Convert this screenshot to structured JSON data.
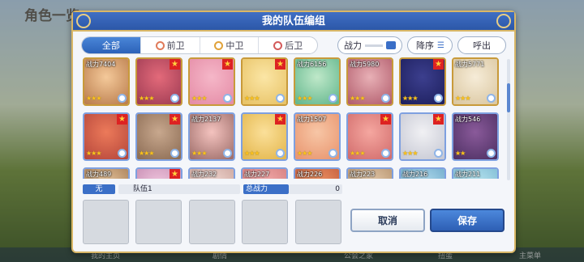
{
  "background": {
    "title": "角色一览",
    "nav": [
      "我的主页",
      "剧情",
      "公会之家",
      "扭蛋",
      "主菜单"
    ]
  },
  "modal": {
    "title": "我的队伍编组"
  },
  "filters": [
    {
      "label": "全部",
      "active": true
    },
    {
      "label": "前卫",
      "active": false
    },
    {
      "label": "中卫",
      "active": false
    },
    {
      "label": "后卫",
      "active": false
    }
  ],
  "controls": {
    "sort_field": "战力",
    "sort_order": "降序",
    "call_out": "呼出"
  },
  "colors": {
    "header": "#2c57a8",
    "gold_border": "#d9b767",
    "accent": "#3b6fc7"
  },
  "roster": [
    {
      "power": "战力7404",
      "stars": "★★★",
      "rare_mark": false,
      "frame": "gold",
      "art": [
        "#f4c99a",
        "#b87a4a"
      ]
    },
    {
      "power": "",
      "stars": "★★★",
      "rare_mark": true,
      "frame": "gold",
      "art": [
        "#e36a7a",
        "#9c3a52"
      ]
    },
    {
      "power": "",
      "stars": "★★★",
      "rare_mark": true,
      "frame": "gold",
      "art": [
        "#f5b7c8",
        "#e48aa5"
      ]
    },
    {
      "power": "",
      "stars": "★★★",
      "rare_mark": true,
      "frame": "gold",
      "art": [
        "#fbe6a6",
        "#e7c163"
      ]
    },
    {
      "power": "战力6156",
      "stars": "★★★",
      "rare_mark": false,
      "frame": "gold",
      "art": [
        "#bfe8c9",
        "#5fb58b"
      ]
    },
    {
      "power": "战力5980",
      "stars": "★★★",
      "rare_mark": false,
      "frame": "gold",
      "art": [
        "#e8b0b6",
        "#b05a6a"
      ]
    },
    {
      "power": "",
      "stars": "★★★",
      "rare_mark": true,
      "frame": "gold",
      "art": [
        "#3c3f8e",
        "#1c1e5c"
      ]
    },
    {
      "power": "战力5771",
      "stars": "★★★",
      "rare_mark": false,
      "frame": "gold",
      "art": [
        "#f6ecd8",
        "#d9c59e"
      ]
    },
    {
      "power": "",
      "stars": "★★★",
      "rare_mark": true,
      "frame": "blue",
      "art": [
        "#ec7a5a",
        "#b4453a"
      ]
    },
    {
      "power": "",
      "stars": "★★★",
      "rare_mark": true,
      "frame": "blue",
      "art": [
        "#c8a88e",
        "#8a6a52"
      ]
    },
    {
      "power": "战力2137",
      "stars": "★★★",
      "rare_mark": false,
      "frame": "blue",
      "art": [
        "#f4c3bf",
        "#9a6a66"
      ]
    },
    {
      "power": "",
      "stars": "★★★",
      "rare_mark": true,
      "frame": "blue",
      "art": [
        "#fbe09a",
        "#e2b448"
      ]
    },
    {
      "power": "战力1507",
      "stars": "★★★",
      "rare_mark": false,
      "frame": "blue",
      "art": [
        "#f7c6a6",
        "#e8936c"
      ]
    },
    {
      "power": "",
      "stars": "★★★",
      "rare_mark": true,
      "frame": "blue",
      "art": [
        "#f5a7a0",
        "#d06a6a"
      ]
    },
    {
      "power": "",
      "stars": "★★★",
      "rare_mark": true,
      "frame": "blue",
      "art": [
        "#f1f1f4",
        "#c4c6d2"
      ]
    },
    {
      "power": "战力546",
      "stars": "★★",
      "rare_mark": false,
      "frame": "blue",
      "art": [
        "#8a5a9a",
        "#4c2f62"
      ]
    },
    {
      "power": "战力489",
      "stars": "",
      "rare_mark": false,
      "frame": "blue",
      "art": [
        "#e9c9a2",
        "#a47a52"
      ]
    },
    {
      "power": "",
      "stars": "",
      "rare_mark": true,
      "frame": "blue",
      "art": [
        "#f2c9e0",
        "#c48ab0"
      ]
    },
    {
      "power": "战力232",
      "stars": "",
      "rare_mark": false,
      "frame": "blue",
      "art": [
        "#f4dcd6",
        "#c9a29a"
      ]
    },
    {
      "power": "战力227",
      "stars": "",
      "rare_mark": false,
      "frame": "blue",
      "art": [
        "#f5b0b0",
        "#d27a7a"
      ]
    },
    {
      "power": "战力226",
      "stars": "",
      "rare_mark": false,
      "frame": "blue",
      "art": [
        "#f29a6a",
        "#c15a3a"
      ]
    },
    {
      "power": "战力223",
      "stars": "",
      "rare_mark": false,
      "frame": "blue",
      "art": [
        "#e9d0b4",
        "#b3906a"
      ]
    },
    {
      "power": "战力216",
      "stars": "",
      "rare_mark": false,
      "frame": "blue",
      "art": [
        "#b8e0f0",
        "#6aa6c8"
      ]
    },
    {
      "power": "战力211",
      "stars": "",
      "rare_mark": false,
      "frame": "blue",
      "art": [
        "#bfe9f2",
        "#7ab8d2"
      ]
    }
  ],
  "team": {
    "tag": "无",
    "name": "队伍1",
    "total_power_label": "总战力",
    "total_power": "0"
  },
  "buttons": {
    "cancel": "取消",
    "save": "保存"
  }
}
